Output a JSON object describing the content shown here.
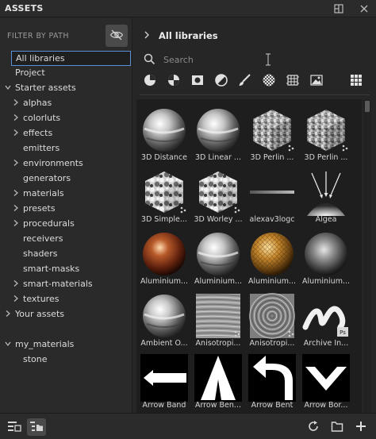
{
  "panel": {
    "title": "ASSETS"
  },
  "filter": {
    "label": "FILTER BY PATH"
  },
  "tree": [
    {
      "label": "All libraries",
      "indent": 0,
      "arrow": "",
      "selected": true
    },
    {
      "label": "Project",
      "indent": 0,
      "arrow": "",
      "selected": false
    },
    {
      "label": "Starter assets",
      "indent": 0,
      "arrow": "v",
      "selected": false
    },
    {
      "label": "alphas",
      "indent": 1,
      "arrow": ">",
      "selected": false
    },
    {
      "label": "colorluts",
      "indent": 1,
      "arrow": ">",
      "selected": false
    },
    {
      "label": "effects",
      "indent": 1,
      "arrow": ">",
      "selected": false
    },
    {
      "label": "emitters",
      "indent": 1,
      "arrow": "",
      "selected": false
    },
    {
      "label": "environments",
      "indent": 1,
      "arrow": ">",
      "selected": false
    },
    {
      "label": "generators",
      "indent": 1,
      "arrow": "",
      "selected": false
    },
    {
      "label": "materials",
      "indent": 1,
      "arrow": ">",
      "selected": false
    },
    {
      "label": "presets",
      "indent": 1,
      "arrow": ">",
      "selected": false
    },
    {
      "label": "procedurals",
      "indent": 1,
      "arrow": ">",
      "selected": false
    },
    {
      "label": "receivers",
      "indent": 1,
      "arrow": "",
      "selected": false
    },
    {
      "label": "shaders",
      "indent": 1,
      "arrow": "",
      "selected": false
    },
    {
      "label": "smart-masks",
      "indent": 1,
      "arrow": "",
      "selected": false
    },
    {
      "label": "smart-materials",
      "indent": 1,
      "arrow": ">",
      "selected": false
    },
    {
      "label": "textures",
      "indent": 1,
      "arrow": ">",
      "selected": false
    },
    {
      "label": "Your assets",
      "indent": 0,
      "arrow": ">",
      "selected": false
    },
    {
      "label": "",
      "indent": 0,
      "arrow": "",
      "selected": false
    },
    {
      "label": "my_materials",
      "indent": 0,
      "arrow": "v",
      "selected": false
    },
    {
      "label": "stone",
      "indent": 1,
      "arrow": "",
      "selected": false
    }
  ],
  "breadcrumb": {
    "current": "All libraries"
  },
  "search": {
    "placeholder": "Search",
    "value": ""
  },
  "assets": [
    {
      "caption": "3D Distance",
      "kind": "sphere-chrome"
    },
    {
      "caption": "3D Linear ...",
      "kind": "sphere-chrome"
    },
    {
      "caption": "3D Perlin ...",
      "kind": "cube-noise"
    },
    {
      "caption": "3D Perlin ...",
      "kind": "cube-noise"
    },
    {
      "caption": "3D Simple...",
      "kind": "cube-cells"
    },
    {
      "caption": "3D Worley ...",
      "kind": "cube-cells"
    },
    {
      "caption": "alexav3logc",
      "kind": "gradient-bar"
    },
    {
      "caption": "Algea",
      "kind": "light-rays"
    },
    {
      "caption": "Aluminium...",
      "kind": "sphere-copper"
    },
    {
      "caption": "Aluminium...",
      "kind": "sphere-chrome"
    },
    {
      "caption": "Aluminium...",
      "kind": "sphere-gold"
    },
    {
      "caption": "Aluminium...",
      "kind": "sphere-dark"
    },
    {
      "caption": "Ambient O...",
      "kind": "sphere-chrome"
    },
    {
      "caption": "Anisotropi...",
      "kind": "aniso-lines"
    },
    {
      "caption": "Anisotropi...",
      "kind": "aniso-swirl"
    },
    {
      "caption": "Archive In...",
      "kind": "brush-ps"
    },
    {
      "caption": "Arrow Band",
      "kind": "arrow-band"
    },
    {
      "caption": "Arrow Ben...",
      "kind": "arrow-ben"
    },
    {
      "caption": "Arrow Bent",
      "kind": "arrow-bent"
    },
    {
      "caption": "Arrow Bor...",
      "kind": "arrow-chevron"
    }
  ],
  "filter_icons": [
    "material-filter-icon",
    "smart-material-filter-icon",
    "texture-filter-icon",
    "mask-filter-icon",
    "brush-filter-icon",
    "alpha-filter-icon",
    "procedural-filter-icon",
    "environment-filter-icon"
  ],
  "bottom_icons": [
    "list-view-icon",
    "folder-view-icon",
    "refresh-icon",
    "new-folder-icon",
    "add-icon"
  ],
  "colors": {
    "selection_border": "#5a8fd6",
    "panel_bg": "#2a2a2a",
    "grid_bg": "#1e1e1e"
  }
}
